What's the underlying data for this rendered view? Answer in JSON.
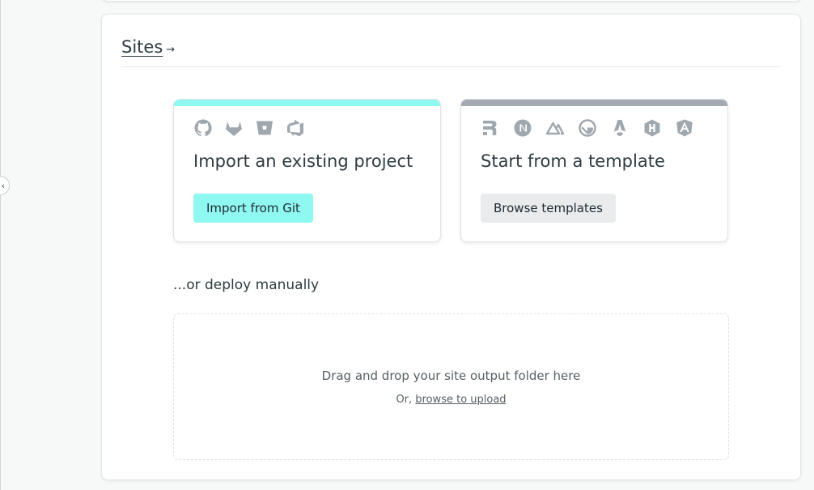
{
  "sidebar": {
    "toggle_glyph": "‹"
  },
  "section": {
    "title": "Sites",
    "arrow": "→"
  },
  "import_card": {
    "title": "Import an existing project",
    "button_label": "Import from Git",
    "icons": [
      "github-icon",
      "gitlab-icon",
      "bitbucket-icon",
      "azure-devops-icon"
    ],
    "accent_color": "#8ff8f0"
  },
  "template_card": {
    "title": "Start from a template",
    "button_label": "Browse templates",
    "icons": [
      "remix-icon",
      "nextjs-icon",
      "nuxt-icon",
      "gatsby-icon",
      "astro-icon",
      "hugo-icon",
      "angular-icon"
    ],
    "accent_color": "#a3aab1"
  },
  "manual": {
    "label": "...or deploy manually",
    "drop_text": "Drag and drop your site output folder here",
    "or_text": "Or,",
    "browse_link": "browse to upload"
  }
}
